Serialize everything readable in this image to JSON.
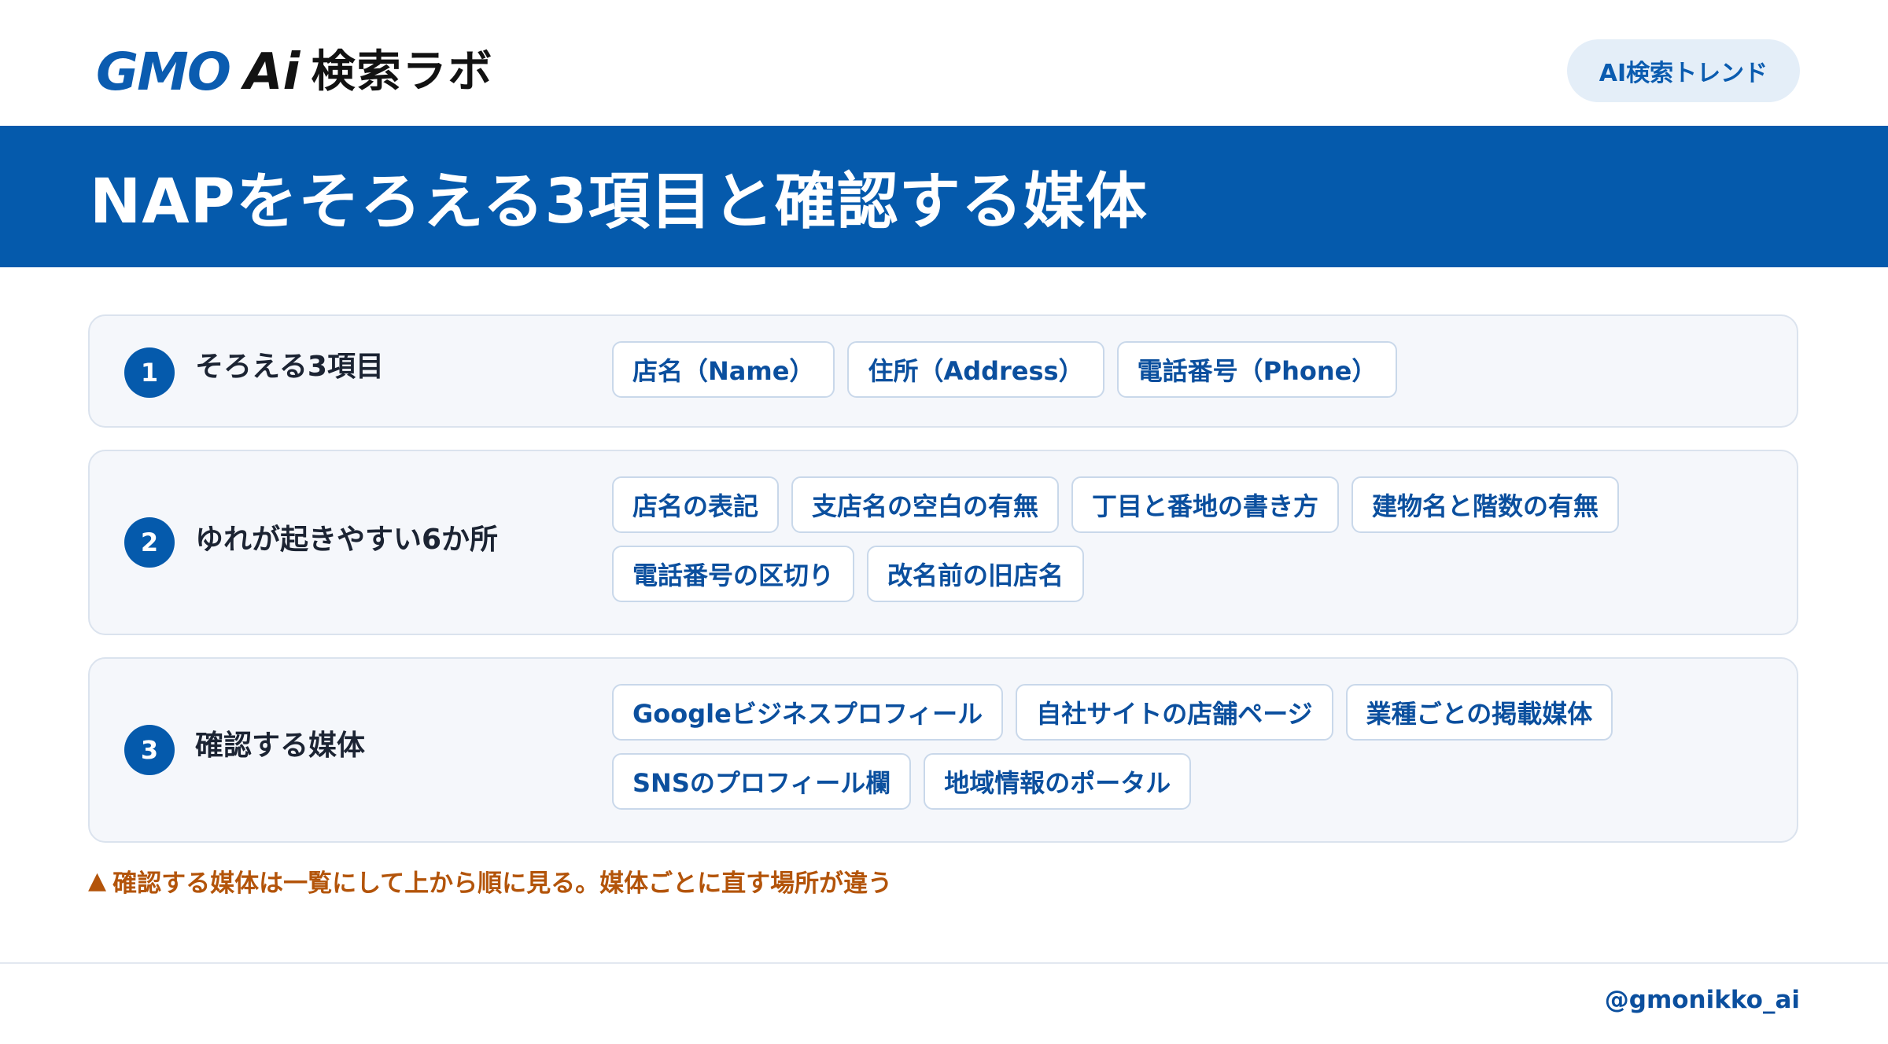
{
  "header": {
    "logo_gmo": "GMO",
    "logo_ai": "Ai",
    "logo_lab": "検索ラボ",
    "trend_label": "AI検索トレンド"
  },
  "title": "NAPをそろえる3項目と確認する媒体",
  "cards": [
    {
      "number": "1",
      "label": "そろえる3項目",
      "chips": [
        "店名（Name）",
        "住所（Address）",
        "電話番号（Phone）"
      ]
    },
    {
      "number": "2",
      "label": "ゆれが起きやすい6か所",
      "chips": [
        "店名の表記",
        "支店名の空白の有無",
        "丁目と番地の書き方",
        "建物名と階数の有無",
        "電話番号の区切り",
        "改名前の旧店名"
      ]
    },
    {
      "number": "3",
      "label": "確認する媒体",
      "chips": [
        "Googleビジネスプロフィール",
        "自社サイトの店舗ページ",
        "業種ごとの掲載媒体",
        "SNSのプロフィール欄",
        "地域情報のポータル"
      ]
    }
  ],
  "note": {
    "icon": "warning-triangle-icon",
    "text": "確認する媒体は一覧にして上から順に見る。媒体ごとに直す場所が違う"
  },
  "footer": {
    "handle": "@gmonikko_ai"
  },
  "colors": {
    "brand_blue": "#055aac",
    "card_bg": "#f5f7fb",
    "note_orange": "#b3540a"
  }
}
